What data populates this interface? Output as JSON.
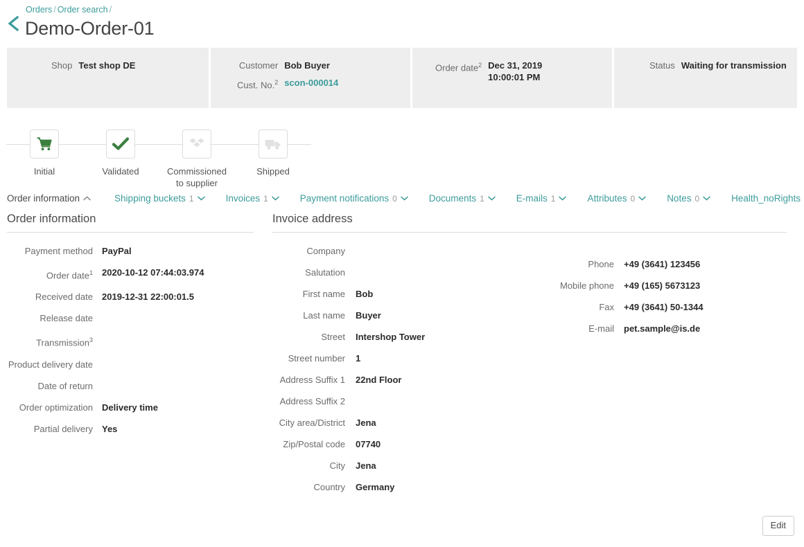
{
  "breadcrumb": {
    "items": [
      "Orders",
      "Order search"
    ],
    "separator": "/"
  },
  "header": {
    "title": "Demo-Order-01",
    "back_icon": "chevron-left-icon"
  },
  "summary": {
    "shop": {
      "label": "Shop",
      "value": "Test shop DE"
    },
    "customer": {
      "label": "Customer",
      "value": "Bob Buyer"
    },
    "customer_no": {
      "label": "Cust. No.",
      "sup": "2",
      "value": "scon-000014"
    },
    "order_date": {
      "label": "Order date",
      "sup": "2",
      "value": "Dec 31, 2019 10:00:01 PM"
    },
    "status": {
      "label": "Status",
      "value": "Waiting for transmission"
    }
  },
  "stepper": {
    "steps": [
      {
        "label": "Initial",
        "icon": "shopping-cart-icon",
        "state": "done"
      },
      {
        "label": "Validated",
        "icon": "check-icon",
        "state": "done"
      },
      {
        "label": "Commissioned to supplier",
        "icon": "box-icon",
        "state": "pending"
      },
      {
        "label": "Shipped",
        "icon": "truck-icon",
        "state": "pending"
      }
    ],
    "colors": {
      "done": "#3c8040",
      "pending": "#e2e2e2"
    }
  },
  "tabs": [
    {
      "label": "Order information",
      "count": null,
      "active": true,
      "chevron": "chevron-up-icon"
    },
    {
      "label": "Shipping buckets",
      "count": "1",
      "active": false,
      "chevron": "chevron-down-icon"
    },
    {
      "label": "Invoices",
      "count": "1",
      "active": false,
      "chevron": "chevron-down-icon"
    },
    {
      "label": "Payment notifications",
      "count": "0",
      "active": false,
      "chevron": "chevron-down-icon"
    },
    {
      "label": "Documents",
      "count": "1",
      "active": false,
      "chevron": "chevron-down-icon"
    },
    {
      "label": "E-mails",
      "count": "1",
      "active": false,
      "chevron": "chevron-down-icon"
    },
    {
      "label": "Attributes",
      "count": "0",
      "active": false,
      "chevron": "chevron-down-icon"
    },
    {
      "label": "Notes",
      "count": "0",
      "active": false,
      "chevron": "chevron-down-icon"
    },
    {
      "label": "Health_noRights",
      "count": null,
      "active": false,
      "chevron": "chevron-down-icon"
    }
  ],
  "order_information": {
    "title": "Order information",
    "fields": [
      {
        "label": "Payment method",
        "sup": "",
        "value": "PayPal"
      },
      {
        "label": "Order date",
        "sup": "1",
        "value": "2020-10-12 07:44:03.974"
      },
      {
        "label": "Received date",
        "sup": "",
        "value": "2019-12-31 22:00:01.5"
      },
      {
        "label": "Release date",
        "sup": "",
        "value": ""
      },
      {
        "label": "Transmission",
        "sup": "3",
        "value": ""
      },
      {
        "label": "Product delivery date",
        "sup": "",
        "value": ""
      },
      {
        "label": "Date of return",
        "sup": "",
        "value": ""
      },
      {
        "label": "Order optimization",
        "sup": "",
        "value": "Delivery time"
      },
      {
        "label": "Partial delivery",
        "sup": "",
        "value": "Yes"
      }
    ]
  },
  "invoice_address": {
    "title": "Invoice address",
    "fields": [
      {
        "label": "Company",
        "value": ""
      },
      {
        "label": "Salutation",
        "value": ""
      },
      {
        "label": "First name",
        "value": "Bob"
      },
      {
        "label": "Last name",
        "value": "Buyer"
      },
      {
        "label": "Street",
        "value": "Intershop Tower"
      },
      {
        "label": "Street number",
        "value": "1"
      },
      {
        "label": "Address Suffix 1",
        "value": "22nd Floor"
      },
      {
        "label": "Address Suffix 2",
        "value": ""
      },
      {
        "label": "City area/District",
        "value": "Jena"
      },
      {
        "label": "Zip/Postal code",
        "value": "07740"
      },
      {
        "label": "City",
        "value": "Jena"
      },
      {
        "label": "Country",
        "value": "Germany"
      }
    ],
    "contact": [
      {
        "label": "Phone",
        "value": "+49 (3641) 123456"
      },
      {
        "label": "Mobile phone",
        "value": "+49 (165) 5673123"
      },
      {
        "label": "Fax",
        "value": "+49 (3641) 50-1344"
      },
      {
        "label": "E-mail",
        "value": "pet.sample@is.de"
      }
    ]
  },
  "actions": {
    "edit_label": "Edit"
  },
  "colors": {
    "accent": "#3d9b9b",
    "green": "#3c8040",
    "card_bg": "#eeeeee",
    "text": "#2b2b2b",
    "muted": "#6b6b6b"
  }
}
